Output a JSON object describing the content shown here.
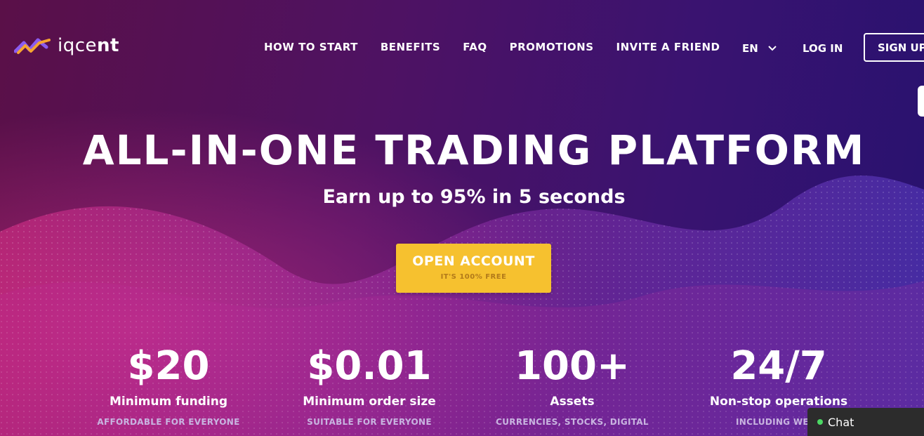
{
  "brand": {
    "name_light": "iqce",
    "name_bold": "nt"
  },
  "nav": {
    "items": [
      {
        "label": "HOW TO START"
      },
      {
        "label": "BENEFITS"
      },
      {
        "label": "FAQ"
      },
      {
        "label": "PROMOTIONS"
      },
      {
        "label": "INVITE A FRIEND"
      }
    ],
    "language": "EN",
    "login": "LOG IN",
    "signup": "SIGN UP"
  },
  "hero": {
    "title": "ALL-IN-ONE TRADING PLATFORM",
    "subtitle": "Earn up to 95% in 5 seconds",
    "cta_label": "OPEN ACCOUNT",
    "cta_note": "IT'S 100% FREE"
  },
  "stats": [
    {
      "value": "$20",
      "label": "Minimum funding",
      "note": "AFFORDABLE FOR EVERYONE"
    },
    {
      "value": "$0.01",
      "label": "Minimum order size",
      "note": "SUITABLE FOR EVERYONE"
    },
    {
      "value": "100+",
      "label": "Assets",
      "note": "CURRENCIES, STOCKS, DIGITAL"
    },
    {
      "value": "24/7",
      "label": "Non-stop operations",
      "note": "INCLUDING WEEK"
    }
  ],
  "chat": {
    "label": "Chat"
  },
  "colors": {
    "cta": "#f6c12f",
    "accent": "#f6a52f",
    "chat_online": "#4cd964"
  }
}
